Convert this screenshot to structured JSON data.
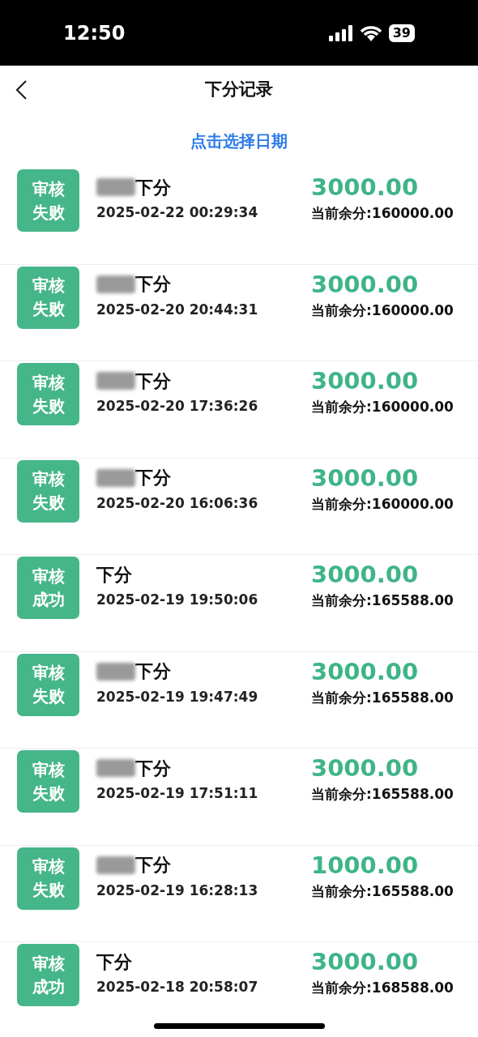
{
  "status_bar": {
    "time": "12:50",
    "battery": "39"
  },
  "header": {
    "title": "下分记录"
  },
  "date_picker": {
    "label": "点击选择日期"
  },
  "records": [
    {
      "badge": [
        "审核",
        "失败"
      ],
      "redacted": true,
      "title": "下分",
      "time": "2025-02-22 00:29:34",
      "amount": "3000.00",
      "balance": "当前余分:160000.00"
    },
    {
      "badge": [
        "审核",
        "失败"
      ],
      "redacted": true,
      "title": "下分",
      "time": "2025-02-20 20:44:31",
      "amount": "3000.00",
      "balance": "当前余分:160000.00"
    },
    {
      "badge": [
        "审核",
        "失败"
      ],
      "redacted": true,
      "title": "下分",
      "time": "2025-02-20 17:36:26",
      "amount": "3000.00",
      "balance": "当前余分:160000.00"
    },
    {
      "badge": [
        "审核",
        "失败"
      ],
      "redacted": true,
      "title": "下分",
      "time": "2025-02-20 16:06:36",
      "amount": "3000.00",
      "balance": "当前余分:160000.00"
    },
    {
      "badge": [
        "审核",
        "成功"
      ],
      "redacted": false,
      "title": "下分",
      "time": "2025-02-19 19:50:06",
      "amount": "3000.00",
      "balance": "当前余分:165588.00"
    },
    {
      "badge": [
        "审核",
        "失败"
      ],
      "redacted": true,
      "title": "下分",
      "time": "2025-02-19 19:47:49",
      "amount": "3000.00",
      "balance": "当前余分:165588.00"
    },
    {
      "badge": [
        "审核",
        "失败"
      ],
      "redacted": true,
      "title": "下分",
      "time": "2025-02-19 17:51:11",
      "amount": "3000.00",
      "balance": "当前余分:165588.00"
    },
    {
      "badge": [
        "审核",
        "失败"
      ],
      "redacted": true,
      "title": "下分",
      "time": "2025-02-19 16:28:13",
      "amount": "1000.00",
      "balance": "当前余分:165588.00"
    },
    {
      "badge": [
        "审核",
        "成功"
      ],
      "redacted": false,
      "title": "下分",
      "time": "2025-02-18 20:58:07",
      "amount": "3000.00",
      "balance": "当前余分:168588.00"
    }
  ]
}
